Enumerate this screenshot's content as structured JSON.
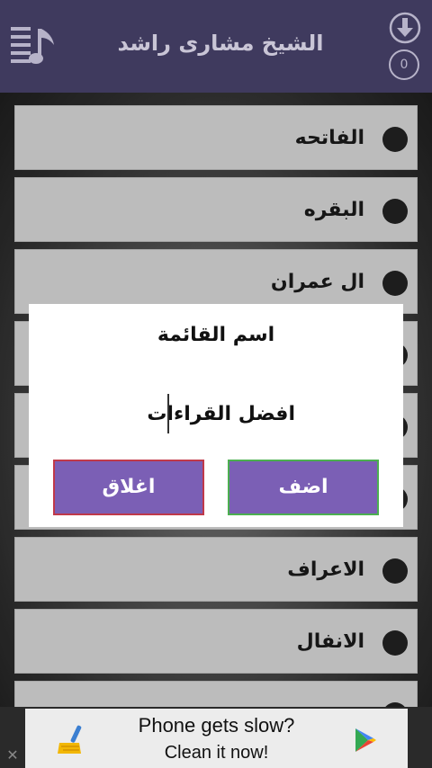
{
  "header": {
    "title": "الشيخ مشارى راشد",
    "download_count": "0",
    "icons": [
      "playlist-icon",
      "download-icon"
    ]
  },
  "surah_list": [
    {
      "name": "الفاتحه"
    },
    {
      "name": "البقره"
    },
    {
      "name": "ال عمران"
    },
    {
      "name": ""
    },
    {
      "name": ""
    },
    {
      "name": ""
    },
    {
      "name": "الاعراف"
    },
    {
      "name": "الانفال"
    },
    {
      "name": ""
    }
  ],
  "dialog": {
    "title": "اسم القائمة",
    "input_value": "افضل القراءات",
    "add_label": "اضف",
    "close_label": "اغلاق"
  },
  "ad": {
    "line1": "Phone gets slow?",
    "line2": "Clean it now!",
    "close_symbol": "✕"
  },
  "colors": {
    "header_bg": "#3f3a5e",
    "button_bg": "#7b5fb5",
    "add_border": "#4caf50",
    "close_border": "#c0394a"
  }
}
